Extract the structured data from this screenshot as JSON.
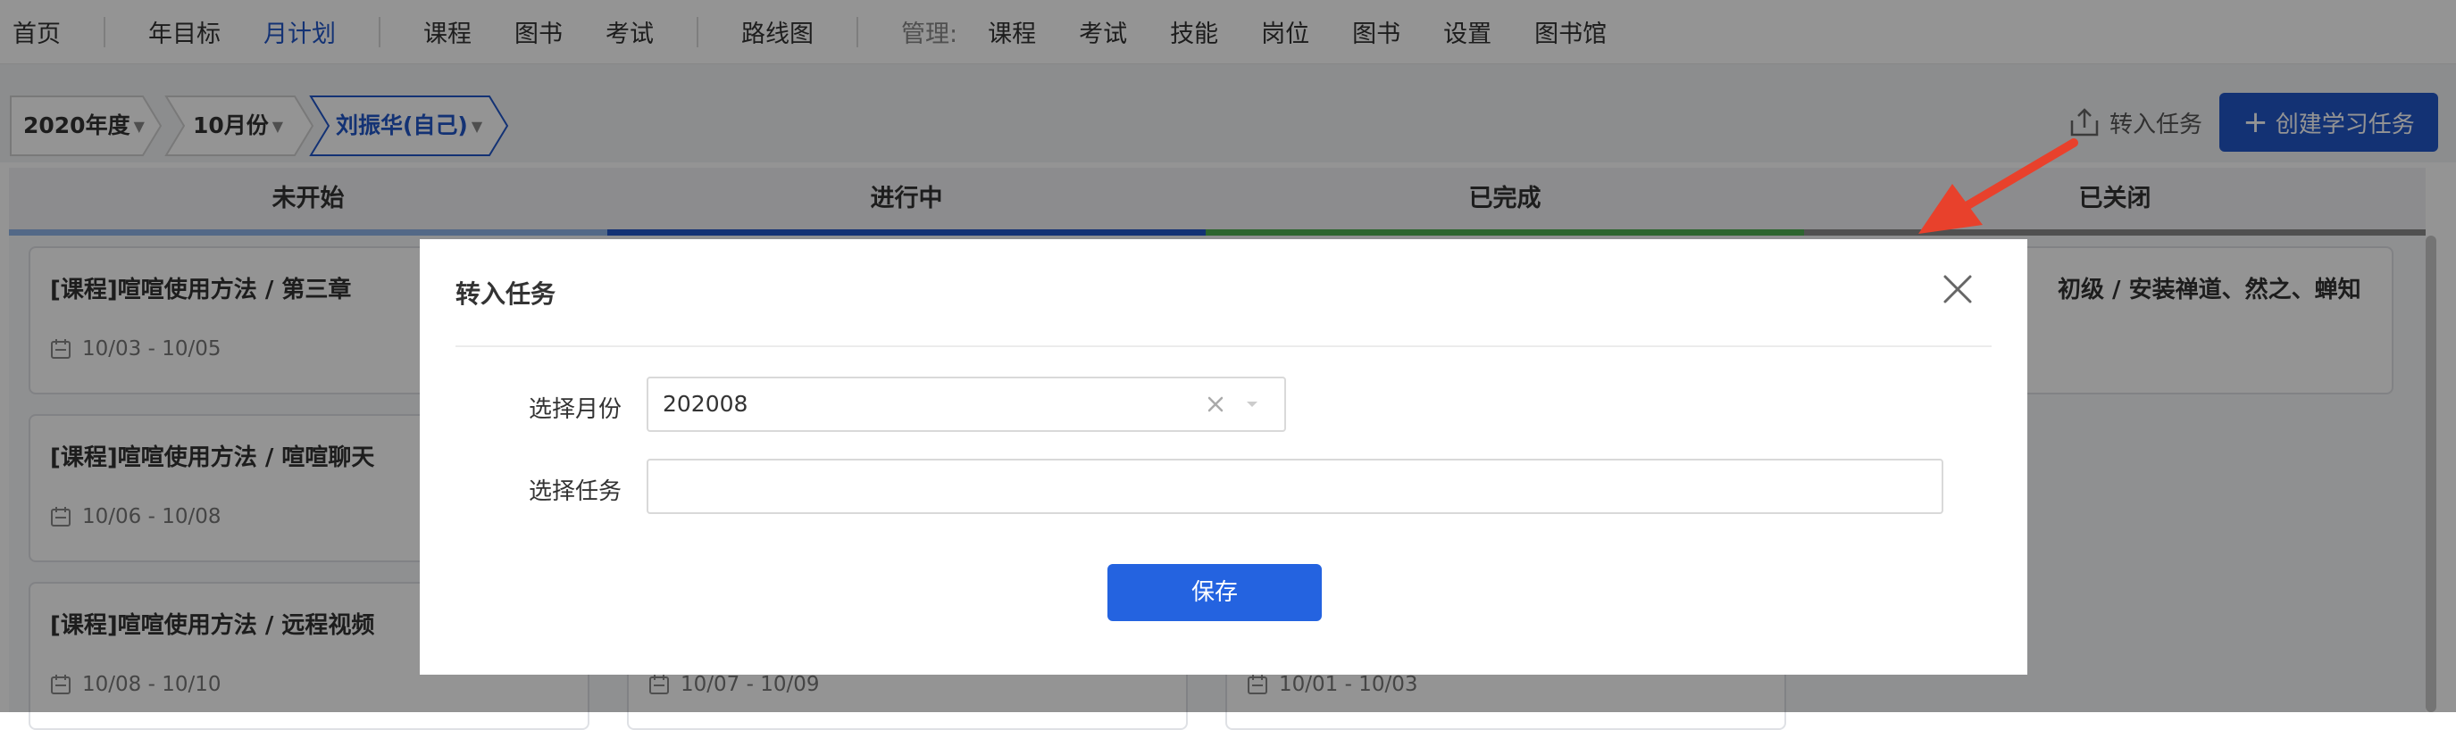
{
  "nav": {
    "items": [
      "首页",
      "年目标",
      "月计划",
      "课程",
      "图书",
      "考试",
      "路线图"
    ],
    "active_index": 2,
    "manage_label": "管理:",
    "manage_items": [
      "课程",
      "考试",
      "技能",
      "岗位",
      "图书",
      "设置",
      "图书馆"
    ]
  },
  "filters": {
    "year": "2020年度",
    "month": "10月份",
    "person": "刘振华(自己)"
  },
  "actions": {
    "import_label": "转入任务",
    "create_label": "创建学习任务",
    "create_icon": "plus-icon",
    "import_icon": "share-upload-icon"
  },
  "columns": [
    {
      "title": "未开始",
      "color": "#8fb6e8",
      "cards": [
        {
          "title": "[课程]喧喧使用方法 / 第三章",
          "date": "10/03 - 10/05"
        },
        {
          "title": "[课程]喧喧使用方法 / 喧喧聊天",
          "date": "10/06 - 10/08"
        },
        {
          "title": "[课程]喧喧使用方法 / 远程视频",
          "date": "10/08 - 10/10"
        }
      ]
    },
    {
      "title": "进行中",
      "color": "#2156c9",
      "cards": [
        {
          "title": "",
          "date": "10/07 - 10/09"
        }
      ]
    },
    {
      "title": "已完成",
      "color": "#4caf50",
      "cards": [
        {
          "title": "",
          "date": "10/01 - 10/03"
        }
      ]
    },
    {
      "title": "已关闭",
      "color": "#8a8a8a",
      "cards": [
        {
          "title": "初级 / 安装禅道、然之、蝉知",
          "date": ""
        }
      ]
    }
  ],
  "modal": {
    "title": "转入任务",
    "month_label": "选择月份",
    "month_value": "202008",
    "task_label": "选择任务",
    "task_value": "",
    "save_label": "保存"
  },
  "colors": {
    "primary": "#2156c9",
    "save_button": "#2463e0",
    "annotation_arrow": "#e8412c"
  }
}
